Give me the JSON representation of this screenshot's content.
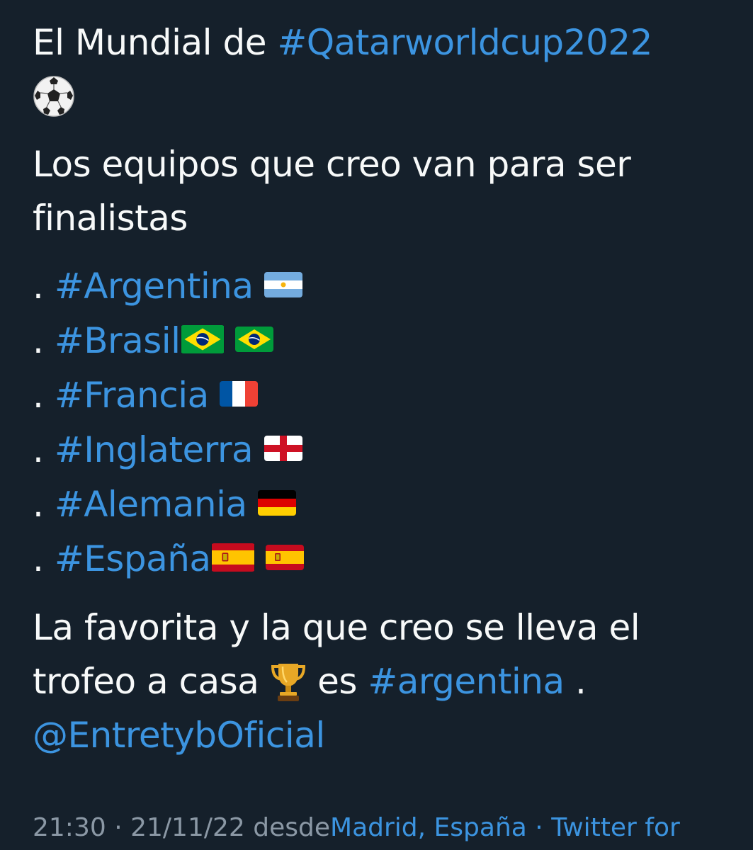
{
  "tweet": {
    "title_prefix": "El Mundial de",
    "title_hashtag": "#Qatarworldcup2022",
    "ball_icon": "soccer-ball-icon",
    "intro_line1": "Los equipos que creo van para ser",
    "intro_line2": "finalistas",
    "teams": [
      {
        "bullet": ".",
        "hashtag": "#Argentina",
        "flags": [
          "argentina-flag-icon"
        ]
      },
      {
        "bullet": ".",
        "hashtag": "#Brasil",
        "flags": [
          "brazil-flag-icon",
          "brazil-flag-icon"
        ]
      },
      {
        "bullet": ".",
        "hashtag": "#Francia",
        "flags": [
          "france-flag-icon"
        ]
      },
      {
        "bullet": ".",
        "hashtag": "#Inglaterra",
        "flags": [
          "england-flag-icon"
        ]
      },
      {
        "bullet": ".",
        "hashtag": "#Alemania",
        "flags": [
          "germany-flag-icon"
        ]
      },
      {
        "bullet": ".",
        "hashtag": "#España",
        "flags": [
          "spain-flag-icon",
          "spain-flag-icon"
        ]
      }
    ],
    "closing_line1": "La favorita y la que creo se lleva el",
    "closing_line2_prefix": "trofeo a casa",
    "trophy_icon": "trophy-icon",
    "closing_line2_mid": "es",
    "closing_hashtag": "#argentina",
    "closing_line2_suffix": ".",
    "mention": "@EntretybOficial"
  },
  "footer": {
    "time": "21:30",
    "separator1": "·",
    "date": "21/11/22",
    "from_label": "desde",
    "location": "Madrid, España",
    "separator2": "·",
    "source": "Twitter for"
  },
  "colors": {
    "background": "#15202b",
    "text": "#f7f9f9",
    "link": "#3c94e0",
    "muted": "#8b98a5"
  }
}
